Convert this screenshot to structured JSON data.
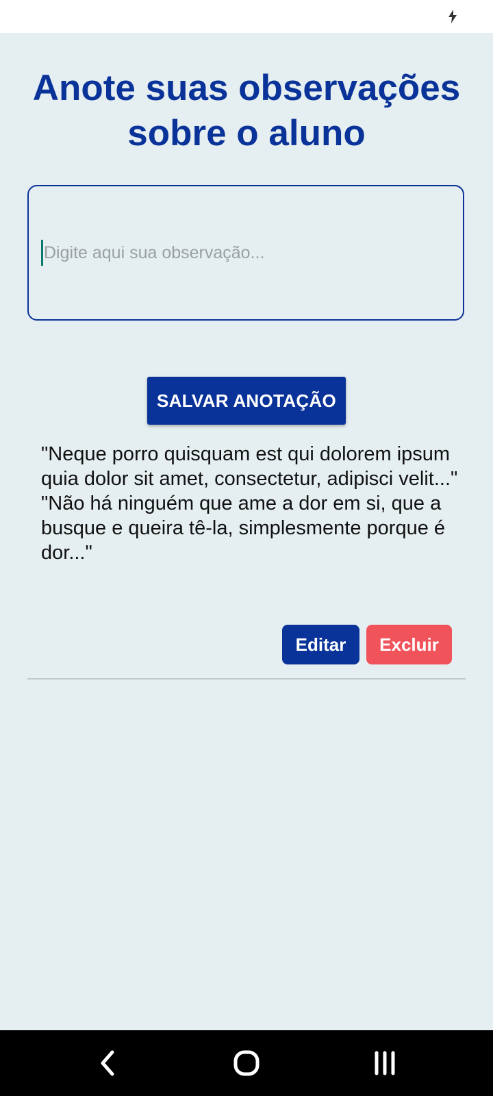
{
  "status_bar": {
    "icons": [
      "charging-bolt-icon"
    ]
  },
  "page": {
    "title": "Anote suas observações sobre o aluno"
  },
  "observation_input": {
    "value": "",
    "placeholder": "Digite aqui sua observação..."
  },
  "save_button": {
    "label": "SALVAR ANOTAÇÃO"
  },
  "note": {
    "paragraph_1": "\"Neque porro quisquam est qui dolorem ipsum quia dolor sit amet, consectetur, adipisci velit...\"",
    "paragraph_2": "\"Não há ninguém que ame a dor em si, que a busque e queira tê-la, simplesmente porque é dor...\""
  },
  "actions": {
    "edit_label": "Editar",
    "delete_label": "Excluir"
  },
  "nav_bar": {
    "buttons": [
      "back-icon",
      "home-icon",
      "recent-apps-icon"
    ]
  },
  "colors": {
    "primary": "#0a3399",
    "danger": "#f0535a",
    "background": "#e5eef0",
    "caret": "#0c7a6b"
  }
}
